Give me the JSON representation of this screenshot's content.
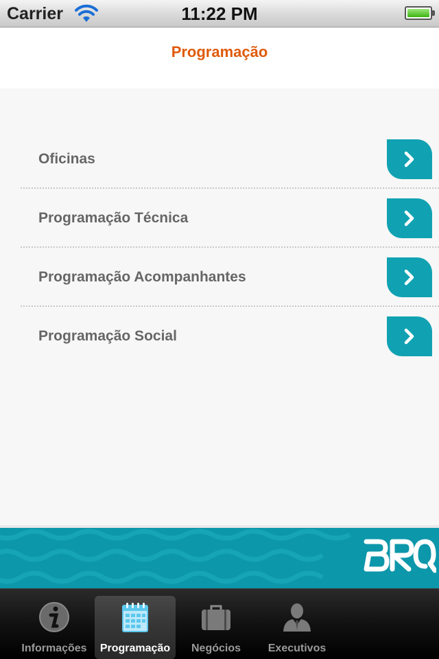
{
  "status_bar": {
    "carrier": "Carrier",
    "time": "11:22 PM",
    "battery_level": 1.0
  },
  "nav": {
    "title": "Programação"
  },
  "menu": {
    "items": [
      {
        "label": "Oficinas"
      },
      {
        "label": "Programação Técnica"
      },
      {
        "label": "Programação Acompanhantes"
      },
      {
        "label": "Programação Social"
      }
    ],
    "arrow_icon": "chevron-right-icon"
  },
  "brand": {
    "logo_text": "BRQ"
  },
  "tabbar": {
    "tabs": [
      {
        "label": "Informações",
        "icon": "info-icon"
      },
      {
        "label": "Programação",
        "icon": "calendar-icon",
        "selected": true
      },
      {
        "label": "Negócios",
        "icon": "briefcase-icon"
      },
      {
        "label": "Executivos",
        "icon": "person-icon"
      }
    ]
  },
  "colors": {
    "title_orange": "#e05a0a",
    "accent_teal": "#10a2b2",
    "brand_band": "#0d97aa"
  }
}
